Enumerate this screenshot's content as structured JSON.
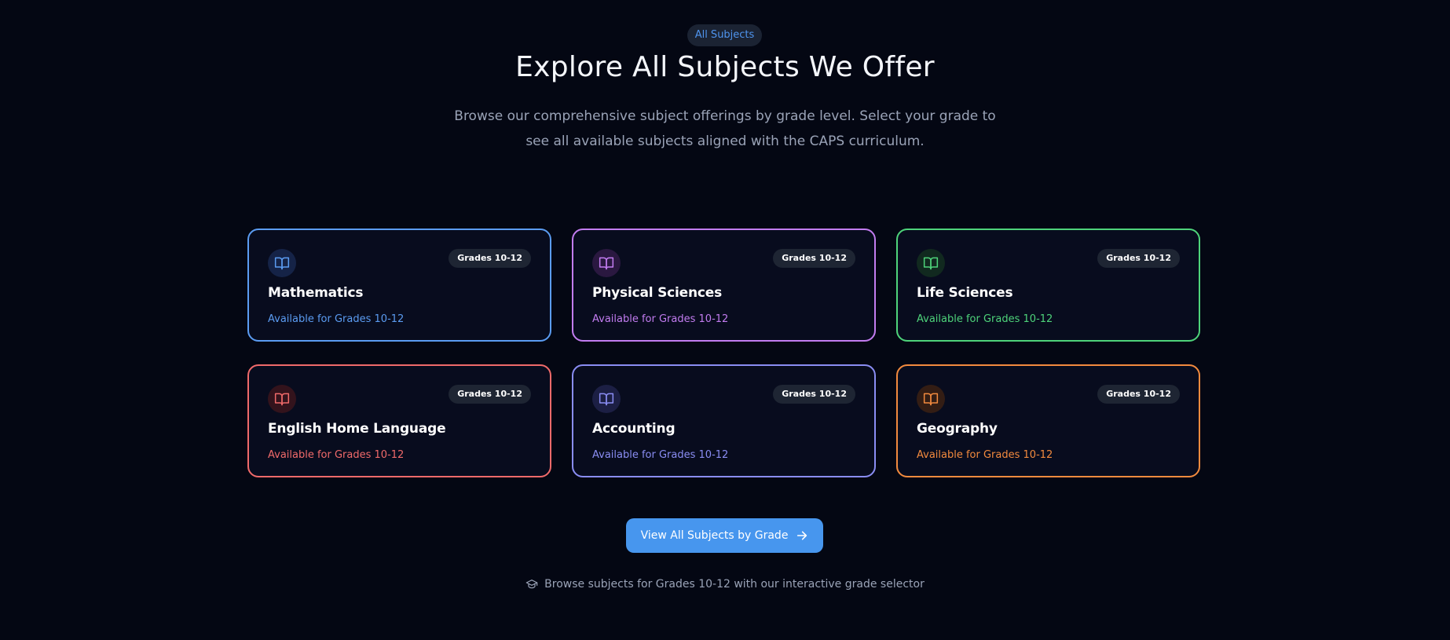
{
  "header": {
    "pill_label": "All Subjects",
    "title": "Explore All Subjects We Offer",
    "subtitle": "Browse our comprehensive subject offerings by grade level. Select your grade to see all available subjects aligned with the CAPS curriculum."
  },
  "subjects": [
    {
      "name": "Mathematics",
      "badge": "Grades 10-12",
      "availability": "Available for Grades 10-12",
      "color": "#5b9cf2",
      "icon_bg": "#152347",
      "icon": "open-book-icon"
    },
    {
      "name": "Physical Sciences",
      "badge": "Grades 10-12",
      "availability": "Available for Grades 10-12",
      "color": "#c27cf0",
      "icon_bg": "#2a1840",
      "icon": "open-book-icon"
    },
    {
      "name": "Life Sciences",
      "badge": "Grades 10-12",
      "availability": "Available for Grades 10-12",
      "color": "#4ed37a",
      "icon_bg": "#11291f",
      "icon": "open-book-icon"
    },
    {
      "name": "English Home Language",
      "badge": "Grades 10-12",
      "availability": "Available for Grades 10-12",
      "color": "#f06a6a",
      "icon_bg": "#33131c",
      "icon": "open-book-icon"
    },
    {
      "name": "Accounting",
      "badge": "Grades 10-12",
      "availability": "Available for Grades 10-12",
      "color": "#8a8df3",
      "icon_bg": "#1c1f44",
      "icon": "open-book-icon"
    },
    {
      "name": "Geography",
      "badge": "Grades 10-12",
      "availability": "Available for Grades 10-12",
      "color": "#f28a3e",
      "icon_bg": "#331d14",
      "icon": "open-book-icon"
    }
  ],
  "cta": {
    "label": "View All Subjects by Grade",
    "icon": "arrow-right-icon",
    "color": "#4796ee"
  },
  "footnote": {
    "icon": "graduation-cap-icon",
    "text": "Browse subjects for Grades 10-12 with our interactive grade selector"
  }
}
